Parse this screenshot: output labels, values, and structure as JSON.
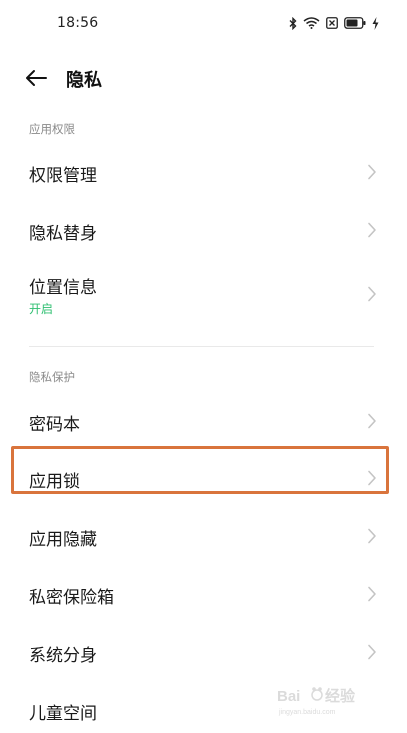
{
  "status_bar": {
    "time": "18:56",
    "icons": [
      "bluetooth-icon",
      "wifi-icon",
      "sim-off-icon",
      "battery-icon",
      "charging-icon"
    ]
  },
  "header": {
    "title": "隐私"
  },
  "sections": [
    {
      "label": "应用权限",
      "items": [
        {
          "label": "权限管理"
        },
        {
          "label": "隐私替身"
        },
        {
          "label": "位置信息",
          "sub": "开启"
        }
      ]
    },
    {
      "label": "隐私保护",
      "items": [
        {
          "label": "密码本"
        },
        {
          "label": "应用锁"
        },
        {
          "label": "应用隐藏"
        },
        {
          "label": "私密保险箱"
        },
        {
          "label": "系统分身"
        },
        {
          "label": "儿童空间"
        }
      ]
    }
  ],
  "colors": {
    "accent_green": "#2fbf71",
    "highlight_orange": "#d9743c"
  }
}
